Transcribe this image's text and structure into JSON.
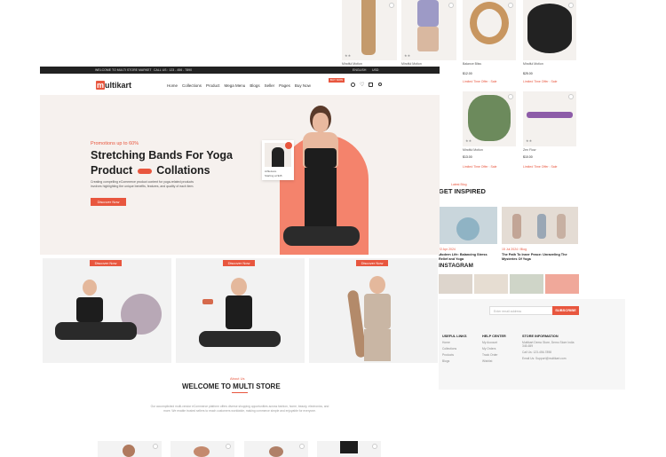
{
  "topbar": {
    "welcome": "WELCOME TO MULTI STORE MARKET",
    "phone": "CALL US : 123 - 456 - 7890",
    "language": "ENGLISH",
    "currency": "USD"
  },
  "brand": {
    "logo_m": "m",
    "logo_rest": "ultikart",
    "accent": "#e8563e"
  },
  "nav": {
    "items": [
      "Home",
      "Collections",
      "Product",
      "Mega Menu",
      "Blogs",
      "Seller",
      "Pages",
      "Buy Now"
    ],
    "badge": "BUY NOW"
  },
  "hero": {
    "promo": "Promotions up to 60%",
    "title_line1": "Stretching Bands For Yoga",
    "title_line2a": "Product",
    "title_line2b": "Collations",
    "desc": "Creating compelling eCommerce product content for yoga-related products involves highlighting the unique benefits, features, and quality of each item.",
    "cta": "Discover Now",
    "mini_card_label": "Athleisure",
    "mini_card_price": "Starting at $45"
  },
  "tiles": {
    "cta": "Discover Now"
  },
  "welcome": {
    "eyebrow": "About Us",
    "title": "WELCOME TO MULTI STORE",
    "body": "Our accomplished multi-vendor eCommerce platform offers diverse shopping opportunities across fashion, home, beauty, electronics, and more. We enable trusted sellers to reach customers worldwide, making commerce simple and enjoyable for everyone."
  },
  "products_top": [
    {
      "name": "Mindful Motion",
      "price": ""
    },
    {
      "name": "Mindful Motion",
      "price": ""
    },
    {
      "name": "Balance Bliss",
      "price": "$12.00"
    },
    {
      "name": "Mindful Motion",
      "price": "$25.00"
    }
  ],
  "offer": "Limited Time Offer : Sale",
  "products_mid": [
    {
      "name": "Mindful Motion",
      "price": "$13.00"
    },
    {
      "name": "Zen Flow",
      "price": "$10.00"
    }
  ],
  "inspired": {
    "eyebrow": "Latest Blog",
    "title": "GET INSPIRED",
    "posts": [
      {
        "date": "22 Apr 2024",
        "title": "Modern Life: Balancing Stress Relief and Yoga"
      },
      {
        "date": "15 Jul 2024 / Blog",
        "title": "The Path To Inner Peace: Unraveling The Mysteries Of Yoga"
      }
    ]
  },
  "instagram": {
    "title": "INSTAGRAM"
  },
  "footer": {
    "email_placeholder": "Enter email address",
    "subscribe": "SUBSCRIBE",
    "cols": [
      {
        "title": "USEFUL LINKS",
        "links": [
          "Home",
          "Collections",
          "Products",
          "Blogs"
        ]
      },
      {
        "title": "HELP CENTER",
        "links": [
          "My Account",
          "My Orders",
          "Track Order",
          "Wishlist"
        ]
      },
      {
        "title": "STORE INFORMATION",
        "links": [
          "Multikart Demo Store, Demo Store India 345-659",
          "Call Us: 123-456-7898",
          "Email Us: Support@multikart.com"
        ]
      }
    ]
  }
}
